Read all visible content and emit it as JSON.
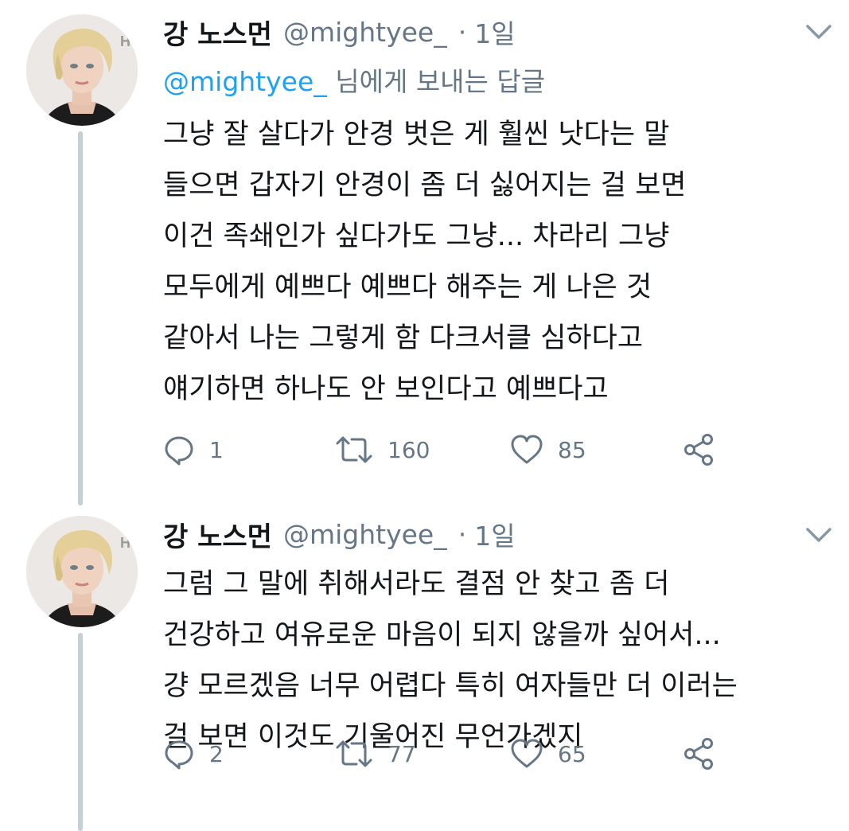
{
  "tweets": [
    {
      "display_name": "강 노스먼",
      "handle": "@mightyee_",
      "separator": "·",
      "time": "1일",
      "replying": {
        "mention": "@mightyee_",
        "suffix": " 님에게 보내는 답글"
      },
      "lines": [
        "그냥 잘 살다가 안경 벗은 게 훨씬 낫다는 말",
        "들으면 갑자기 안경이 좀 더 싫어지는 걸 보면",
        "이건 족쇄인가 싶다가도 그냥... 차라리 그냥",
        "모두에게 예쁘다 예쁘다 해주는 게 나은 것",
        "같아서 나는 그렇게 함 다크서클 심하다고",
        "얘기하면 하나도 안 보인다고 예쁘다고"
      ],
      "actions": {
        "replies": "1",
        "retweets": "160",
        "likes": "85"
      }
    },
    {
      "display_name": "강 노스먼",
      "handle": "@mightyee_",
      "separator": "·",
      "time": "1일",
      "lines": [
        "그럼 그 말에 취해서라도 결점 안 찾고 좀 더",
        "건강하고 여유로운 마음이 되지 않을까 싶어서...",
        "걍 모르겠음 너무 어렵다 특히 여자들만 더 이러는",
        "걸 보면 이것도 기울어진 무언가겠지"
      ],
      "actions": {
        "replies": "2",
        "retweets": "77",
        "likes": "65"
      }
    }
  ],
  "icons": [
    "reply-icon",
    "retweet-icon",
    "like-icon",
    "share-icon",
    "chevron-down-icon"
  ],
  "colors": {
    "text": "#14171a",
    "secondary": "#657786",
    "link": "#1da1f2",
    "thread_line": "#c4cfd6"
  }
}
